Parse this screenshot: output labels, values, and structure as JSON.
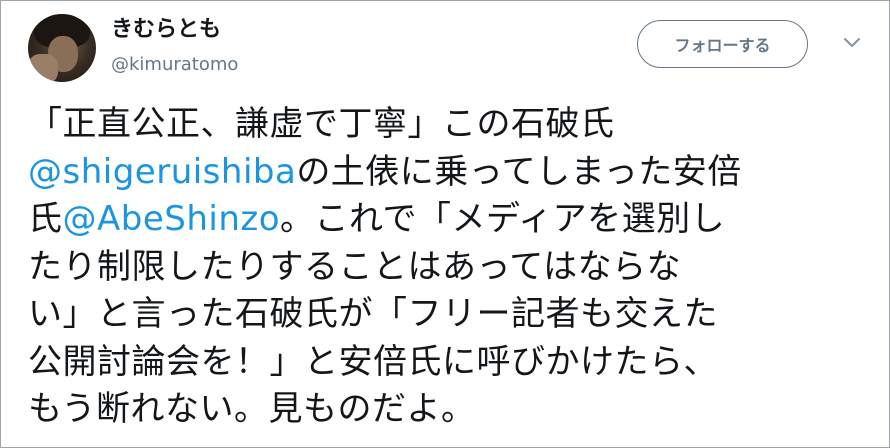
{
  "user": {
    "display_name": "きむらとも",
    "handle": "@kimuratomo"
  },
  "follow_button": {
    "label": "フォローする"
  },
  "menu_icon": "chevron-down-icon",
  "tweet": {
    "line1": "「正直公正、謙虚で丁寧」この石破氏",
    "line2_mention": "@shigeruishiba",
    "line2_text": "の土俵に乗ってしまった安倍",
    "line3_prefix": "氏",
    "line3_mention": "@AbeShinzo",
    "line3_text": "。これで「メディアを選別し",
    "line4": "たり制限したりすることはあってはならな",
    "line5": "い」と言った石破氏が「フリー記者も交えた",
    "line6": "公開討論会を！」と安倍氏に呼びかけたら、",
    "line7": "もう断れない。見ものだよ。"
  },
  "colors": {
    "mention": "#1b95e0",
    "text": "#14171a",
    "secondary": "#657786"
  }
}
